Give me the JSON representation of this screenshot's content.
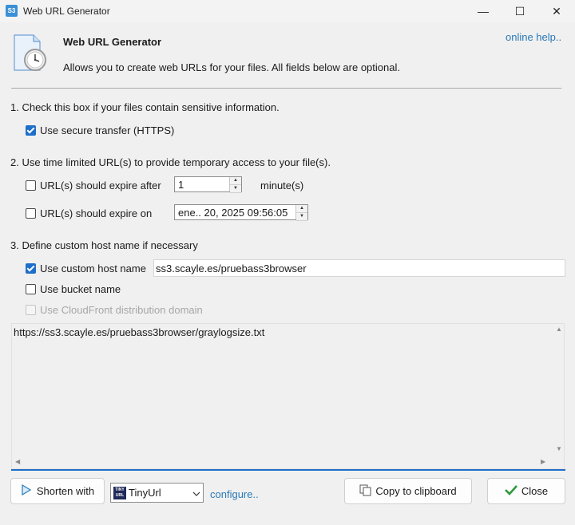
{
  "window": {
    "app_icon_text": "S3",
    "title": "Web URL Generator",
    "minimize_glyph": "—",
    "maximize_glyph": "☐",
    "close_glyph": "✕"
  },
  "header": {
    "title": "Web URL Generator",
    "description": "Allows you to create web URLs for your files. All fields below are optional.",
    "help_link": "online help.."
  },
  "section1": {
    "heading": "1. Check this box if your files contain sensitive information.",
    "https": {
      "label": "Use secure transfer (HTTPS)",
      "checked": true
    }
  },
  "section2": {
    "heading": "2. Use time limited URL(s) to provide temporary access to your file(s).",
    "expire_after": {
      "label": "URL(s) should expire after",
      "checked": false,
      "value": "1",
      "unit": "minute(s)"
    },
    "expire_on": {
      "label": "URL(s) should expire on",
      "checked": false,
      "value": "ene.. 20, 2025 09:56:05"
    }
  },
  "section3": {
    "heading": "3. Define custom host name if necessary",
    "custom_host": {
      "label": "Use custom host name",
      "checked": true,
      "value": "ss3.scayle.es/pruebass3browser"
    },
    "bucket_name": {
      "label": "Use bucket name",
      "checked": false
    },
    "cloudfront": {
      "label": "Use CloudFront distribution domain",
      "checked": false,
      "disabled": true
    }
  },
  "output": {
    "url": "https://ss3.scayle.es/pruebass3browser/graylogsize.txt"
  },
  "footer": {
    "shorten_label": "Shorten with",
    "shortener_logo": "TINY URL",
    "shortener_selected": "TinyUrl",
    "configure_link": "configure..",
    "copy_label": "Copy to clipboard",
    "close_label": "Close"
  },
  "colors": {
    "accent": "#1e6fc9",
    "link": "#2a7ab8",
    "background": "#f0f0f0"
  }
}
